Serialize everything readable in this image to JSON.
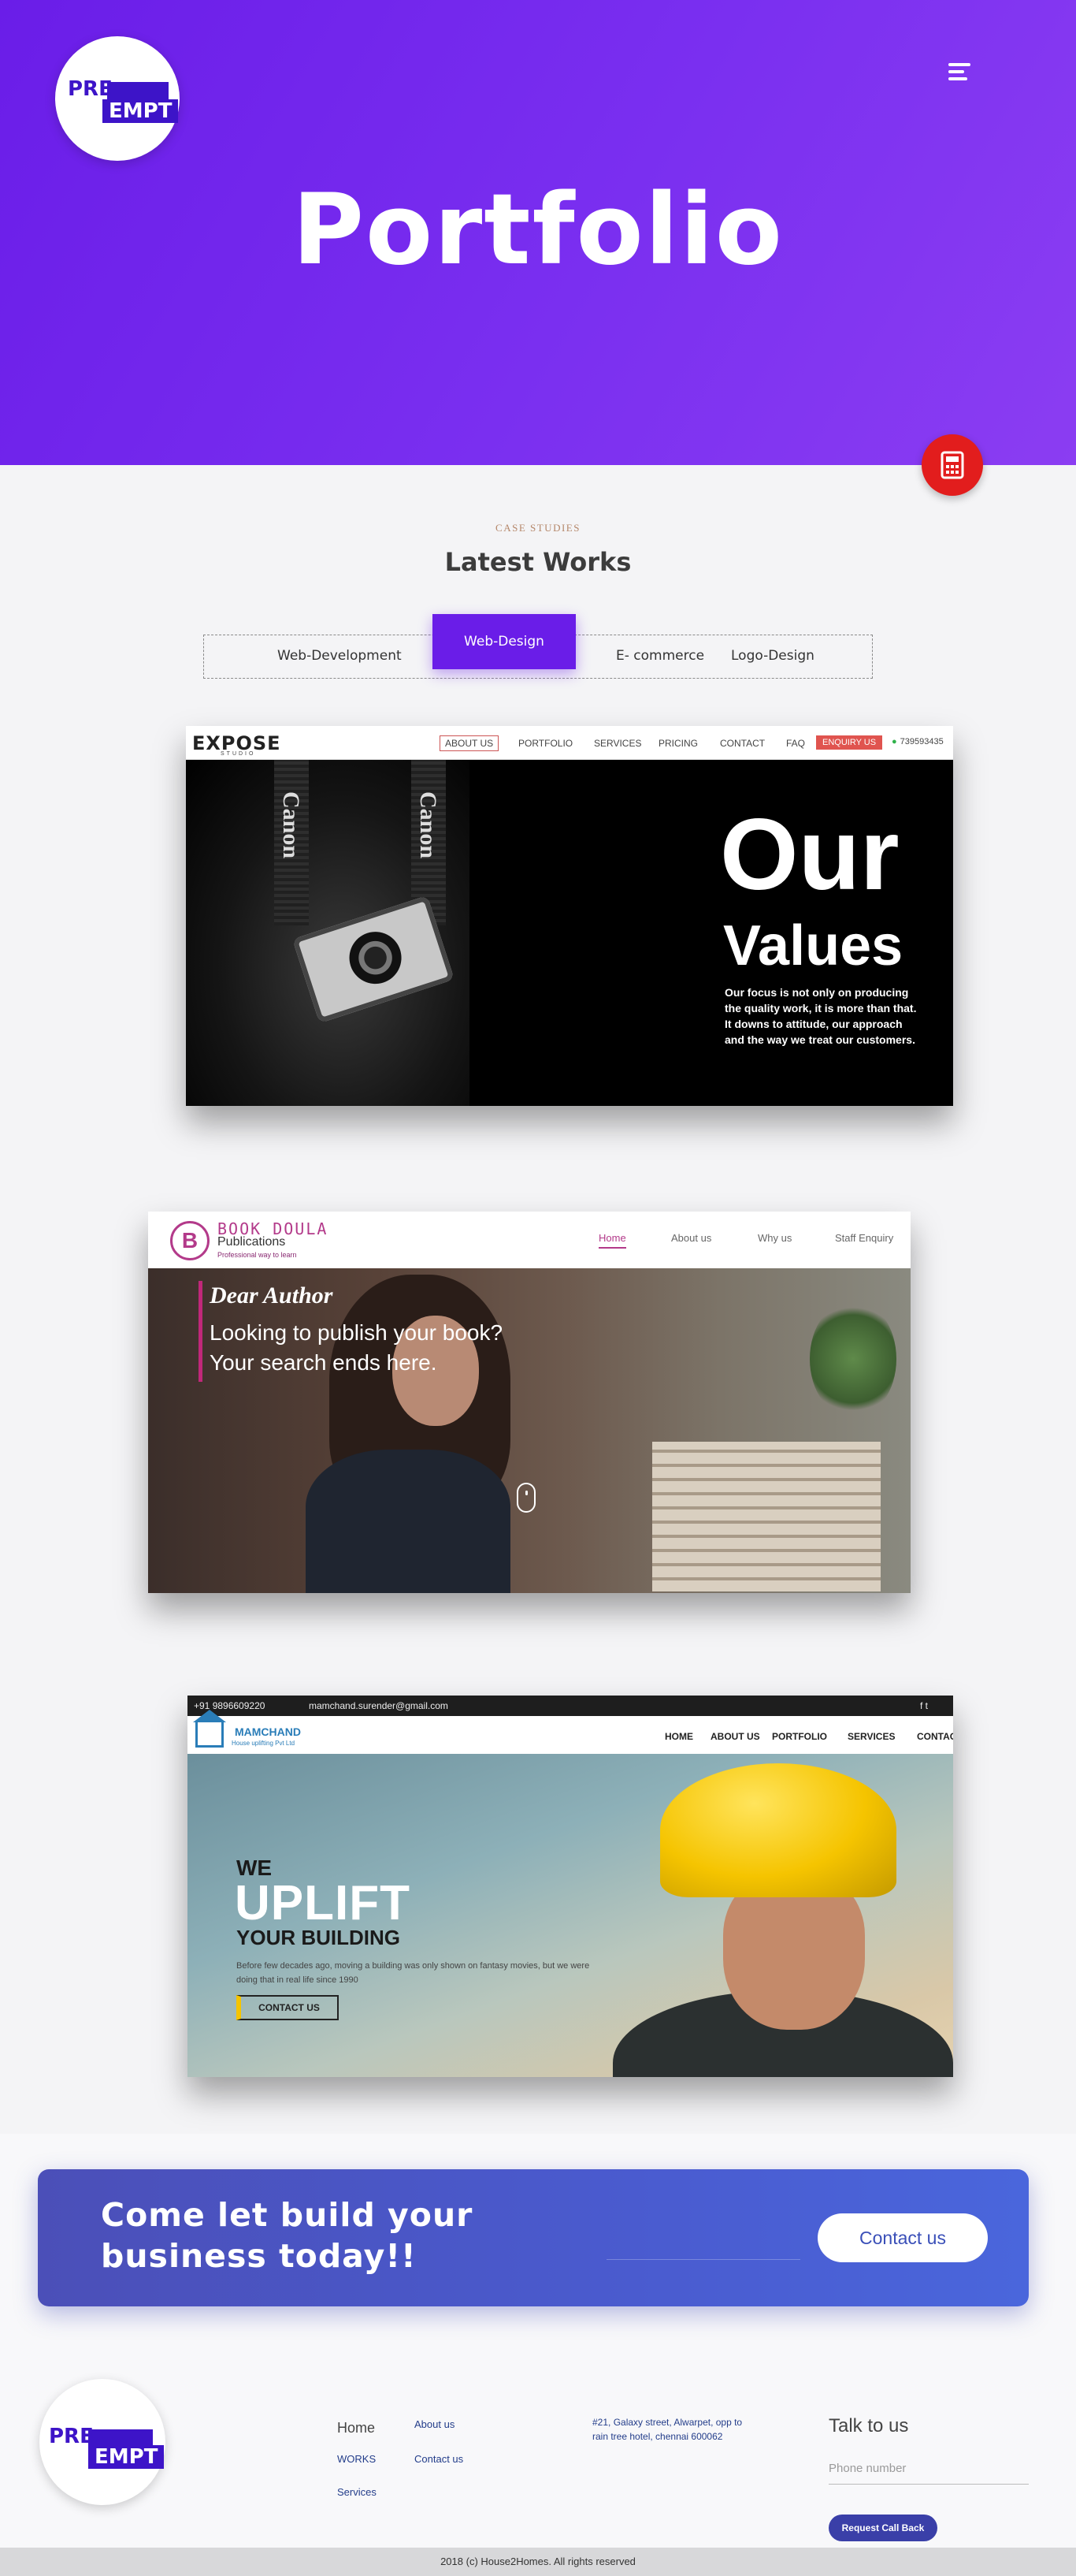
{
  "hero": {
    "logo_top": "PRE",
    "logo_bottom": "EMPT",
    "title": "Portfolio"
  },
  "works": {
    "eyebrow": "CASE STUDIES",
    "title": "Latest Works",
    "filters": [
      "Web-Development",
      "Web-Design",
      "E- commerce",
      "Logo-Design"
    ],
    "active_filter": "Web-Design"
  },
  "shot1": {
    "brand": "EXPOSE",
    "brand_sub": "STUDIO",
    "nav": [
      "ABOUT US",
      "PORTFOLIO",
      "SERVICES",
      "PRICING",
      "CONTACT",
      "FAQ"
    ],
    "enquiry": "ENQUIRY US",
    "phone": "739593435",
    "strap_text": "Canon",
    "headline_1": "Our",
    "headline_2": "Values",
    "description": "Our focus is not only on producing the quality work, it is more than that. It downs to attitude, our approach and the way we treat our customers."
  },
  "shot2": {
    "brand_mark": "B",
    "brand_1": "BOOK DOULA",
    "brand_2": "Publications",
    "tagline": "Professional way to learn",
    "nav": [
      "Home",
      "About us",
      "Why us",
      "Staff Enquiry"
    ],
    "greeting": "Dear Author",
    "line_1": "Looking to publish your book?",
    "line_2": "Your search ends here."
  },
  "shot3": {
    "phone": "+91 9896609220",
    "email": "mamchand.surender@gmail.com",
    "social": "f  t",
    "brand_1": "MAMCHAND",
    "brand_2": "House uplifting Pvt Ltd",
    "nav": [
      "HOME",
      "ABOUT US",
      "PORTFOLIO",
      "SERVICES",
      "CONTAC"
    ],
    "we": "WE",
    "uplift": "UPLIFT",
    "your_building": "YOUR BUILDING",
    "para": "Before few decades ago, moving a building was only shown on fantasy movies, but we were doing that in real life since 1990",
    "cta": "CONTACT US"
  },
  "cta_card": {
    "line_1": "Come let build your",
    "line_2": "business today!!",
    "button": "Contact us"
  },
  "footer": {
    "logo_top": "PRE",
    "logo_bottom": "EMPT",
    "col1": [
      "Home",
      "WORKS",
      "Services"
    ],
    "col2": [
      "About us",
      "Contact us"
    ],
    "address": "#21, Galaxy street, Alwarpet, opp to rain tree hotel, chennai 600062",
    "talk_title": "Talk to us",
    "phone_placeholder": "Phone number",
    "request_button": "Request Call Back",
    "copyright": "2018 (c) House2Homes. All rights reserved"
  },
  "colors": {
    "hero_start": "#6a1de8",
    "hero_end": "#8b3df2",
    "accent_red": "#e21d1d",
    "cta_card": "#4a5bcf",
    "brand_purple": "#3d14c8"
  },
  "icons": [
    "menu-icon",
    "calculator-icon",
    "whatsapp-icon",
    "mouse-scroll-icon",
    "house-icon",
    "phone-icon",
    "mail-icon"
  ]
}
